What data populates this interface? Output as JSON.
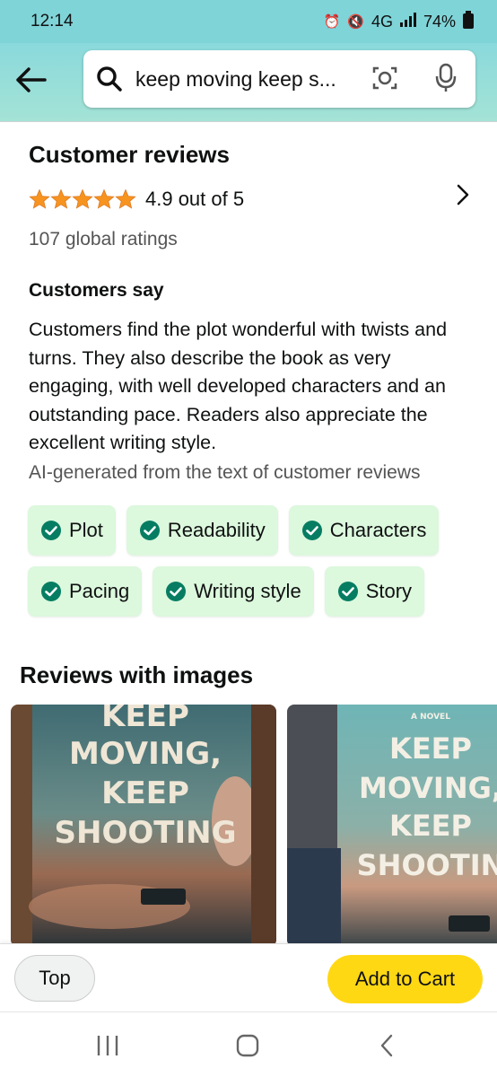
{
  "status": {
    "time": "12:14",
    "network": "4G",
    "battery": "74%"
  },
  "search": {
    "query": "keep moving keep s..."
  },
  "reviews": {
    "title": "Customer reviews",
    "rating_text": "4.9 out of 5",
    "rating_value": 4.9,
    "global_ratings": "107 global ratings",
    "customers_say_title": "Customers say",
    "summary": "Customers find the plot wonderful with twists and turns. They also describe the book as very engaging, with well developed characters and an outstanding pace. Readers also appreciate the excellent writing style.",
    "ai_note": "AI-generated from the text of customer reviews",
    "chips": [
      {
        "label": "Plot"
      },
      {
        "label": "Readability"
      },
      {
        "label": "Characters"
      },
      {
        "label": "Pacing"
      },
      {
        "label": "Writing style"
      },
      {
        "label": "Story"
      }
    ]
  },
  "images_section": {
    "title": "Reviews with images",
    "images": [
      {
        "lines": [
          "KEEP",
          "MOVING,",
          "KEEP",
          "SHOOTING"
        ]
      },
      {
        "tag": "A NOVEL",
        "lines": [
          "KEEP",
          "MOVING,",
          "KEEP",
          "SHOOTIN"
        ]
      }
    ]
  },
  "bottom": {
    "top_label": "Top",
    "cart_label": "Add to Cart"
  },
  "colors": {
    "header": "#8ad9dc",
    "star": "#f79420",
    "chip_bg": "#dcf8dd",
    "check": "#067d62",
    "cart": "#ffd814"
  }
}
